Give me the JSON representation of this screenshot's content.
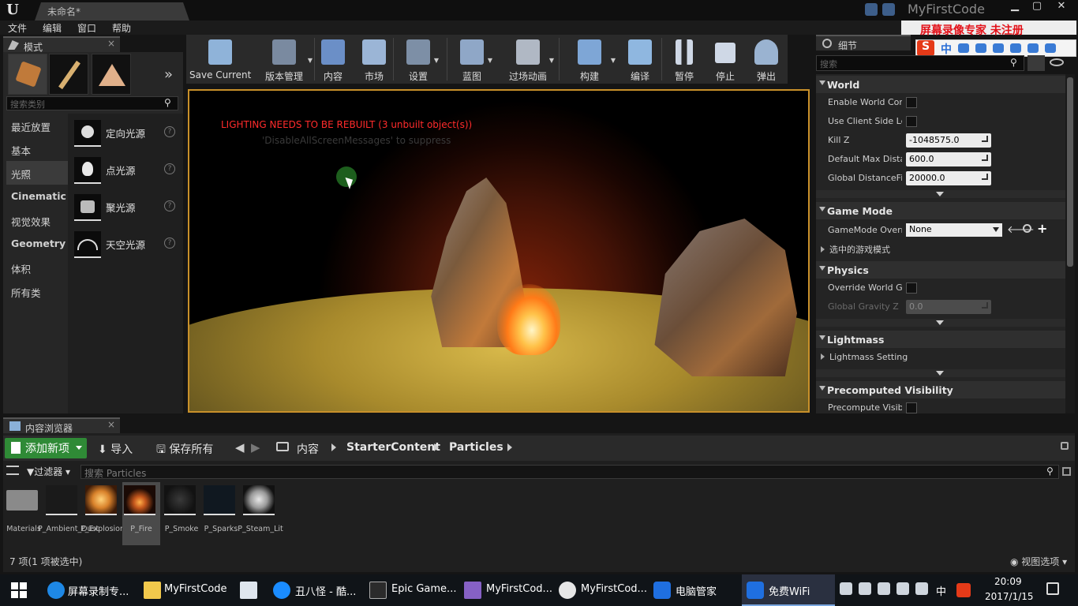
{
  "window": {
    "doc_tab": "未命名*",
    "project_name": "MyFirstCode",
    "min": "▁",
    "max": "▢",
    "close": "✕"
  },
  "menu": [
    "文件",
    "编辑",
    "窗口",
    "帮助"
  ],
  "modes": {
    "tab_label": "模式",
    "close": "×",
    "search_placeholder": "搜索类别",
    "more": "»",
    "categories": [
      "最近放置",
      "基本",
      "光照",
      "Cinematic",
      "视觉效果",
      "Geometry",
      "体积",
      "所有类"
    ],
    "active_category": "光照",
    "items": [
      "定向光源",
      "点光源",
      "聚光源",
      "天空光源"
    ],
    "help": "?"
  },
  "toolbar": {
    "items": [
      {
        "label": "Save Current",
        "icon": "save-icon",
        "color": "#8fb3d9"
      },
      {
        "label": "版本管理",
        "icon": "source-control-icon",
        "color": "#7a8aa0"
      },
      {
        "label": "内容",
        "icon": "content-icon",
        "color": "#6b8fc7"
      },
      {
        "label": "市场",
        "icon": "marketplace-icon",
        "color": "#9bb5d6"
      },
      {
        "label": "设置",
        "icon": "settings-icon",
        "color": "#7d8fa6"
      },
      {
        "label": "蓝图",
        "icon": "blueprint-icon",
        "color": "#8fa7c7"
      },
      {
        "label": "过场动画",
        "icon": "cinematics-icon",
        "color": "#b0b8c4"
      },
      {
        "label": "构建",
        "icon": "build-icon",
        "color": "#7ea6d6"
      },
      {
        "label": "编译",
        "icon": "compile-icon",
        "color": "#8fb7e0"
      },
      {
        "label": "暂停",
        "icon": "pause-icon",
        "color": "#cfd8e6"
      },
      {
        "label": "停止",
        "icon": "stop-icon",
        "color": "#cfd8e6"
      },
      {
        "label": "弹出",
        "icon": "eject-icon",
        "color": "#9ab3d1"
      }
    ]
  },
  "viewport": {
    "warning": "LIGHTING NEEDS TO BE REBUILT (3 unbuilt object(s))",
    "sub": "'DisableAllScreenMessages' to suppress"
  },
  "details": {
    "tab_label": "细节",
    "search_placeholder": "搜索",
    "sections": {
      "world": "World",
      "game_mode": "Game Mode",
      "physics": "Physics",
      "lightmass": "Lightmass",
      "precomputed": "Precomputed Visibility"
    },
    "world_props": {
      "enable_world_comp": "Enable World Comp",
      "use_client_side": "Use Client Side Le",
      "kill_z": "Kill Z",
      "kill_z_value": "-1048575.0",
      "default_max_dist": "Default Max Distai",
      "default_max_dist_value": "600.0",
      "global_distance": "Global DistanceFie",
      "global_distance_value": "20000.0"
    },
    "game_mode_props": {
      "override": "GameMode Overri",
      "override_value": "None",
      "selected": "选中的游戏模式"
    },
    "physics_props": {
      "override_gravity": "Override World Gra",
      "global_gravity": "Global Gravity Z",
      "global_gravity_value": "0.0"
    },
    "lightmass_props": {
      "setting": "Lightmass Setting"
    },
    "precomputed_props": {
      "visibility": "Precompute Visibi"
    }
  },
  "overlay": {
    "recorder_text": "屏幕录像专家  未注册",
    "ime_logo": "S",
    "ime_mode": "中"
  },
  "content_browser": {
    "tab_label": "内容浏览器",
    "close": "×",
    "add_new": "添加新项",
    "import": "⬇ 导入",
    "save_all": "🖫 保存所有",
    "back": "◀",
    "forward": "▶",
    "breadcrumb": [
      "内容",
      "StarterContent",
      "Particles"
    ],
    "filter": "▼过滤器 ▾",
    "search_placeholder": "搜索 Particles",
    "assets": [
      {
        "name": "Materials",
        "color": "#8a8a8a"
      },
      {
        "name": "P_Ambient_Dust",
        "color": "#1a1a1a"
      },
      {
        "name": "P_Explosion",
        "color": "#d9822b"
      },
      {
        "name": "P_Fire",
        "color": "#c4561c"
      },
      {
        "name": "P_Smoke",
        "color": "#2a2a2a"
      },
      {
        "name": "P_Sparks",
        "color": "#101820"
      },
      {
        "name": "P_Steam_Lit",
        "color": "#cfcfcf"
      }
    ],
    "selected_asset": "P_Fire",
    "count_text": "7 项(1 项被选中)",
    "view_options": "◉ 视图选项 ▾"
  },
  "taskbar": {
    "items": [
      {
        "label": "屏幕录制专...",
        "icon": "ie-icon",
        "color": "#1e88e5"
      },
      {
        "label": "MyFirstCode",
        "icon": "folder-icon",
        "color": "#f2c94c"
      },
      {
        "label": "",
        "icon": "store-icon",
        "color": "#dfe6ee"
      },
      {
        "label": "丑八怪 - 酷...",
        "icon": "kugou-icon",
        "color": "#1a8cff"
      },
      {
        "label": "Epic Game...",
        "icon": "epic-icon",
        "color": "#2b2b2b"
      },
      {
        "label": "MyFirstCod...",
        "icon": "visual-studio-icon",
        "color": "#8661c5"
      },
      {
        "label": "MyFirstCod...",
        "icon": "unreal-icon",
        "color": "#e6e6e6"
      },
      {
        "label": "电脑管家",
        "icon": "pc-manager-icon",
        "color": "#1f6fe0"
      },
      {
        "label": "免费WiFi",
        "icon": "wifi-shield-icon",
        "color": "#1f6fe0"
      }
    ],
    "tray_ime": "中",
    "time": "20:09",
    "date": "2017/1/15"
  }
}
